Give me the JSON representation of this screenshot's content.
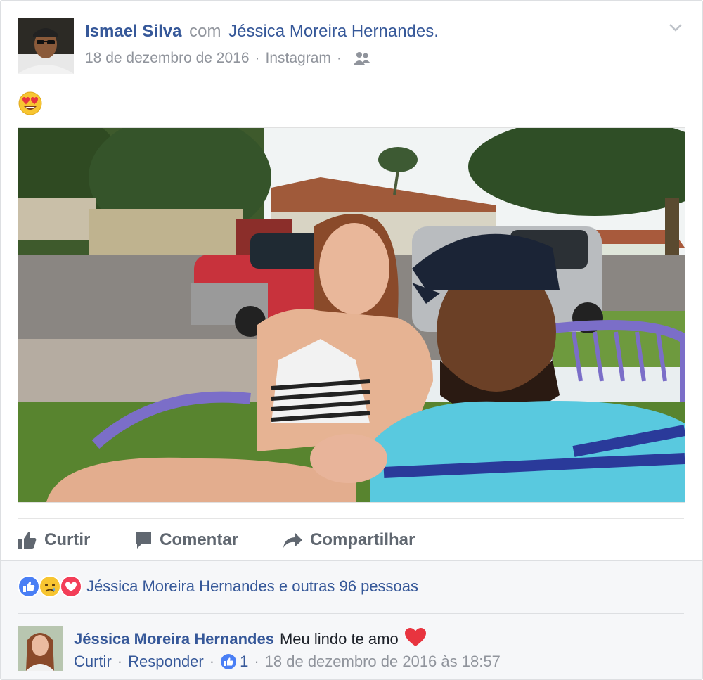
{
  "post": {
    "author": "Ismael Silva",
    "with_word": "com",
    "tagged": "Jéssica Moreira Hernandes",
    "period": ".",
    "date": "18 de dezembro de 2016",
    "separator": "·",
    "source": "Instagram",
    "audience_icon": "friends-icon",
    "content_emoji_icon": "heart-eyes-emoji-icon"
  },
  "actions": {
    "like_label": "Curtir",
    "comment_label": "Comentar",
    "share_label": "Compartilhar"
  },
  "reactions": {
    "icons": [
      "like-reaction-icon",
      "sad-reaction-icon",
      "love-reaction-icon"
    ],
    "summary": "Jéssica Moreira Hernandes e outras 96 pessoas"
  },
  "comment": {
    "author": "Jéssica Moreira Hernandes",
    "text": "Meu lindo te amo",
    "heart_icon": "red-heart-icon",
    "like_link": "Curtir",
    "reply_link": "Responder",
    "separator": "·",
    "like_count": "1",
    "timestamp": "18 de dezembro de 2016 às 18:57"
  },
  "colors": {
    "link": "#365899",
    "meta": "#90949c",
    "action": "#606770",
    "like_blue": "#4267b2",
    "love_red": "#f33e58"
  }
}
